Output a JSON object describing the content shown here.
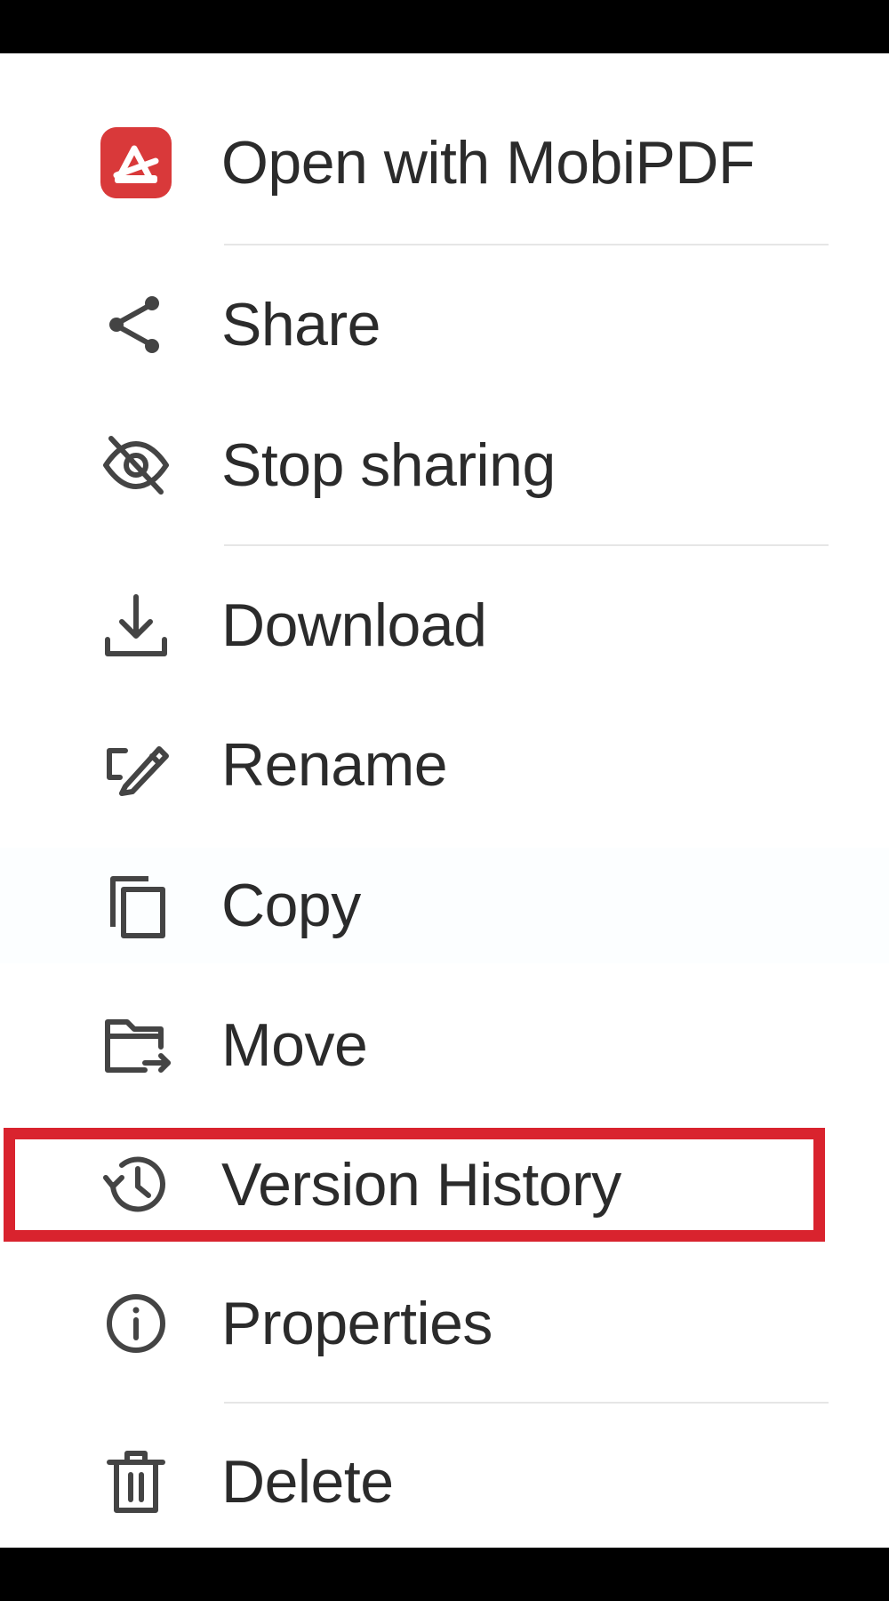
{
  "menu": {
    "items": [
      {
        "id": "open-with",
        "label": "Open with MobiPDF",
        "icon": "mobipdf-app-icon"
      },
      {
        "id": "share",
        "label": "Share",
        "icon": "share-icon"
      },
      {
        "id": "stop-sharing",
        "label": "Stop sharing",
        "icon": "eye-off-icon"
      },
      {
        "id": "download",
        "label": "Download",
        "icon": "download-icon"
      },
      {
        "id": "rename",
        "label": "Rename",
        "icon": "rename-pencil-icon"
      },
      {
        "id": "copy",
        "label": "Copy",
        "icon": "copy-icon"
      },
      {
        "id": "move",
        "label": "Move",
        "icon": "folder-move-icon"
      },
      {
        "id": "version-history",
        "label": "Version History",
        "icon": "history-icon"
      },
      {
        "id": "properties",
        "label": "Properties",
        "icon": "info-icon"
      },
      {
        "id": "delete",
        "label": "Delete",
        "icon": "trash-icon"
      }
    ]
  },
  "colors": {
    "brand_red": "#d9393a",
    "highlight_red": "#d9232e",
    "text": "#2b2b2b",
    "icon": "#444444",
    "divider": "#e6e6e6"
  },
  "highlighted_item": "version-history"
}
